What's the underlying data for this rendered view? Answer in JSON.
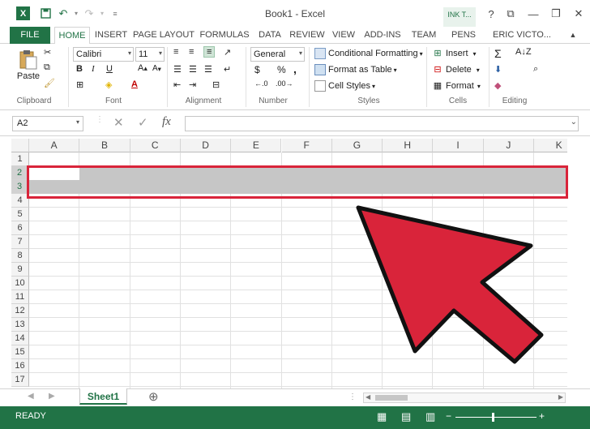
{
  "window": {
    "title": "Book1 - Excel",
    "logo_text": "X",
    "contextual_tab": "INK T..."
  },
  "tabs": [
    "FILE",
    "HOME",
    "INSERT",
    "PAGE LAYOUT",
    "FORMULAS",
    "DATA",
    "REVIEW",
    "VIEW",
    "ADD-INS",
    "TEAM",
    "PENS",
    "ERIC VICTO..."
  ],
  "active_tab": "HOME",
  "ribbon": {
    "clipboard": {
      "label": "Clipboard",
      "paste": "Paste"
    },
    "font": {
      "label": "Font",
      "family": "Calibri",
      "size": "11",
      "bold": "B",
      "italic": "I",
      "underline": "U"
    },
    "alignment": {
      "label": "Alignment"
    },
    "number": {
      "label": "Number",
      "format": "General",
      "currency": "$",
      "percent": "%",
      "comma": ","
    },
    "styles": {
      "label": "Styles",
      "conditional": "Conditional Formatting",
      "format_table": "Format as Table",
      "cell_styles": "Cell Styles"
    },
    "cells": {
      "label": "Cells",
      "insert": "Insert",
      "delete": "Delete",
      "format": "Format"
    },
    "editing": {
      "label": "Editing",
      "sum": "Σ"
    }
  },
  "formula_bar": {
    "name_box": "A2",
    "fx": "fx",
    "cancel": "✕",
    "enter": "✓",
    "value": ""
  },
  "columns": [
    "A",
    "B",
    "C",
    "D",
    "E",
    "F",
    "G",
    "H",
    "I",
    "J",
    "K"
  ],
  "rows": [
    "1",
    "2",
    "3",
    "4",
    "5",
    "6",
    "7",
    "8",
    "9",
    "10",
    "11",
    "12",
    "13",
    "14",
    "15",
    "16",
    "17"
  ],
  "selected_rows": [
    "2",
    "3"
  ],
  "sheet_tab": "Sheet1",
  "add_sheet": "⊕",
  "status": {
    "ready": "READY"
  },
  "colors": {
    "excel_green": "#217346",
    "highlight_red": "#d9243a",
    "selection_gray": "#c6c6c6"
  }
}
